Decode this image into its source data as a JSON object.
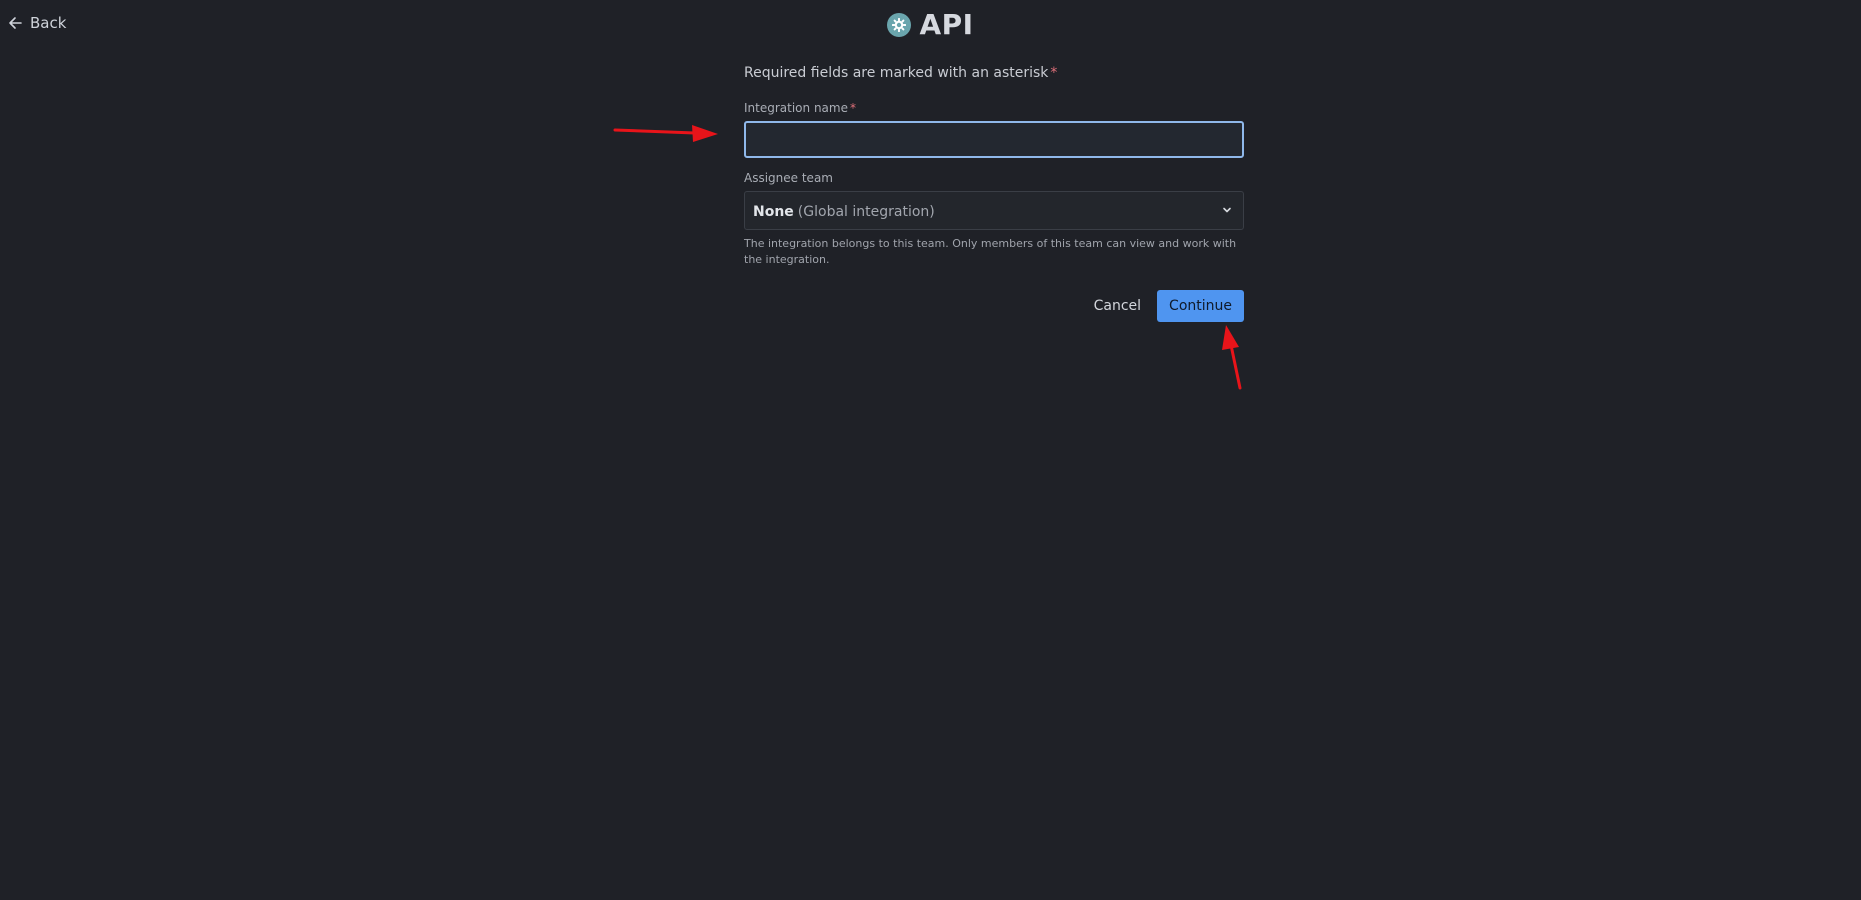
{
  "nav": {
    "back_label": "Back"
  },
  "header": {
    "title": "API",
    "icon": "gear-icon"
  },
  "form": {
    "required_note": "Required fields are marked with an asterisk",
    "required_marker": "*",
    "integration_name": {
      "label": "Integration name",
      "value": "",
      "placeholder": ""
    },
    "assignee_team": {
      "label": "Assignee team",
      "selected_strong": "None",
      "selected_muted": "(Global integration)",
      "helper": "The integration belongs to this team. Only members of this team can view and work with the integration."
    },
    "cancel_label": "Cancel",
    "continue_label": "Continue"
  },
  "colors": {
    "background": "#1f2127",
    "accent": "#4f95f0",
    "focus_border": "#8fb8ea",
    "asterisk": "#e0707a",
    "annotation_arrow": "#e8141a"
  }
}
